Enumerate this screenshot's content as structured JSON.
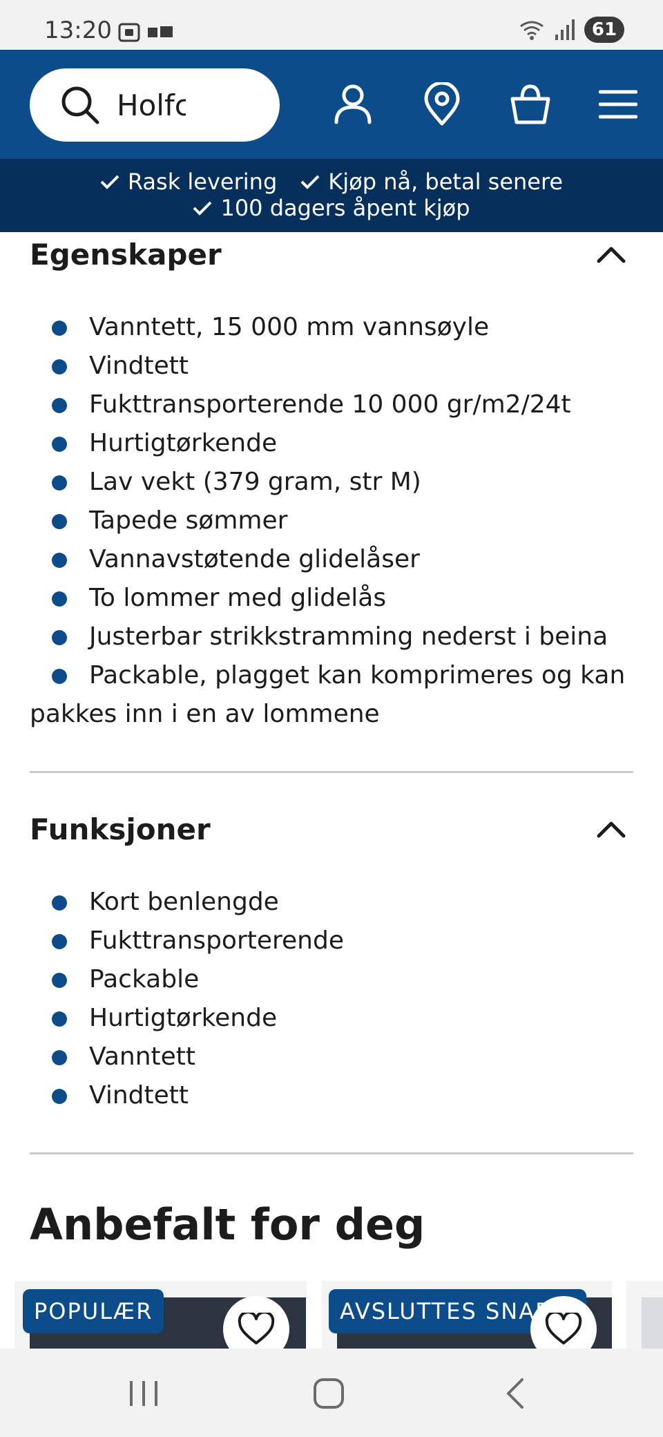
{
  "status_bar": {
    "time": "13:20",
    "battery": "61",
    "icons": [
      "screenshot-icon",
      "notification-icon",
      "wifi-icon",
      "signal-icon",
      "battery-icon"
    ]
  },
  "header": {
    "search_value": "Holfc",
    "icons": [
      "search-icon",
      "account-icon",
      "store-location-icon",
      "cart-icon",
      "menu-icon"
    ],
    "brand_color": "#0d4c8b"
  },
  "usp": {
    "items": [
      "Rask levering",
      "Kjøp nå, betal senere",
      "100 dagers åpent kjøp"
    ],
    "background": "#062f5c"
  },
  "features": {
    "title": "Egenskaper",
    "items": [
      "Vanntett, 15 000 mm vannsøyle",
      "Vindtett",
      "Fukttransporterende 10 000 gr/m2/24t",
      "Hurtigtørkende",
      "Lav vekt (379 gram, str M)",
      "Tapede sømmer",
      "Vannavstøtende glidelåser",
      "To lommer med glidelås",
      "Justerbar strikkstramming nederst i beina",
      "Packable, plagget kan komprimeres og kan pakkes inn i en av lommene"
    ]
  },
  "functions": {
    "title": "Funksjoner",
    "items": [
      "Kort benlengde",
      "Fukttransporterende",
      "Packable",
      "Hurtigtørkende",
      "Vanntett",
      "Vindtett"
    ]
  },
  "recommended": {
    "title": "Anbefalt for deg",
    "cards": [
      {
        "badge": "POPULÆR"
      },
      {
        "badge": "AVSLUTTES SNART!"
      }
    ]
  },
  "nav_bar": {
    "icons": [
      "recent-apps-icon",
      "home-icon",
      "back-icon"
    ]
  }
}
